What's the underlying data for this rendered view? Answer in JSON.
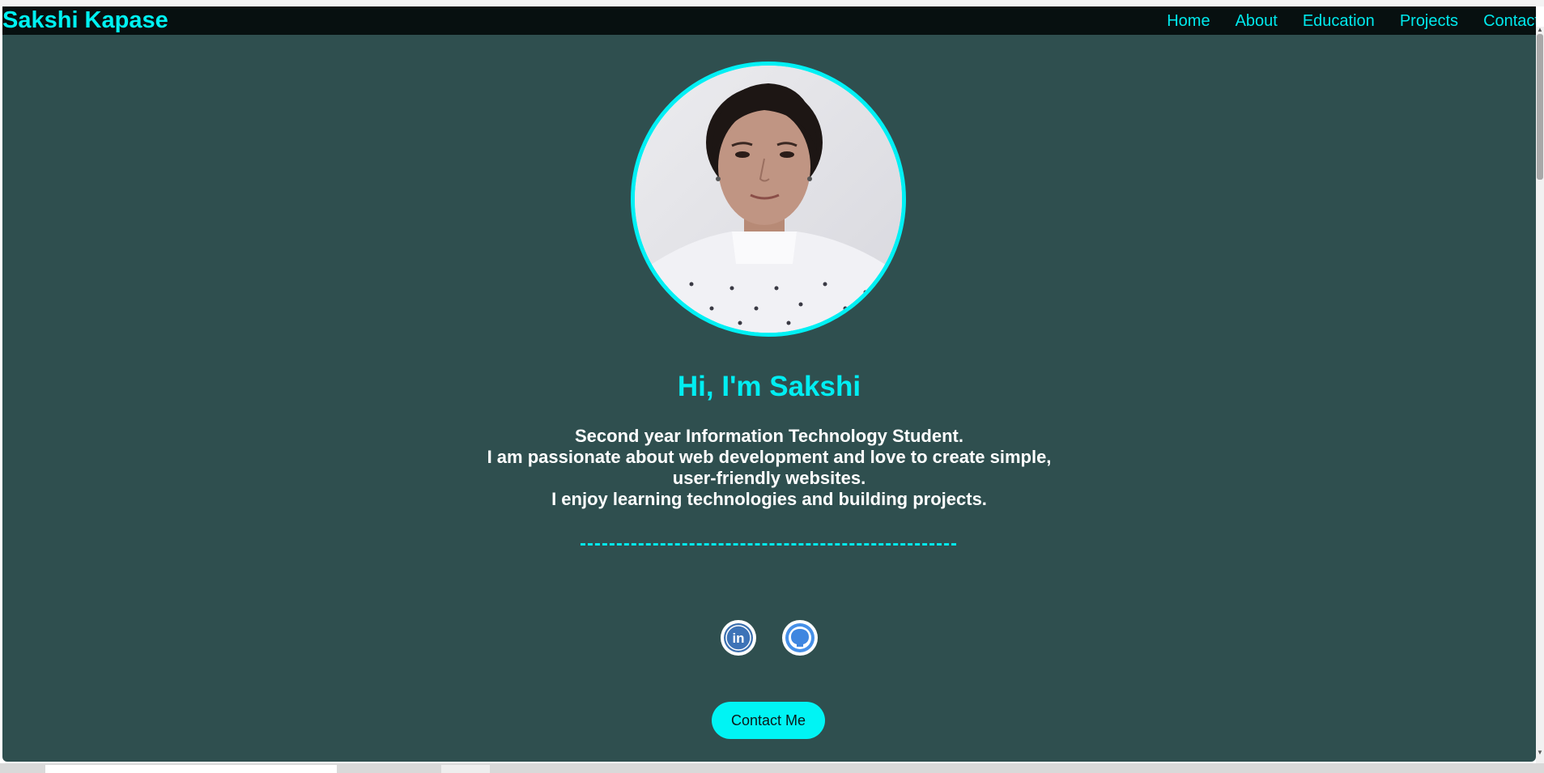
{
  "brand": "Sakshi Kapase",
  "nav": [
    "Home",
    "About",
    "Education",
    "Projects",
    "Contact"
  ],
  "hero": {
    "title": "Hi, I'm Sakshi",
    "bio_lines": [
      "Second year Information Technology Student.",
      "I am passionate about web development and love to create simple,",
      "user-friendly websites.",
      "I enjoy learning technologies and building projects."
    ],
    "divider": "-------------------------------------------------------"
  },
  "socials": [
    {
      "name": "linkedin-icon",
      "label": "in"
    },
    {
      "name": "github-icon",
      "label": ""
    }
  ],
  "contact_button": "Contact Me",
  "colors": {
    "background": "#2f4f4f",
    "accent": "#00f0f4",
    "navbar": "#071010",
    "text": "#ffffff"
  }
}
